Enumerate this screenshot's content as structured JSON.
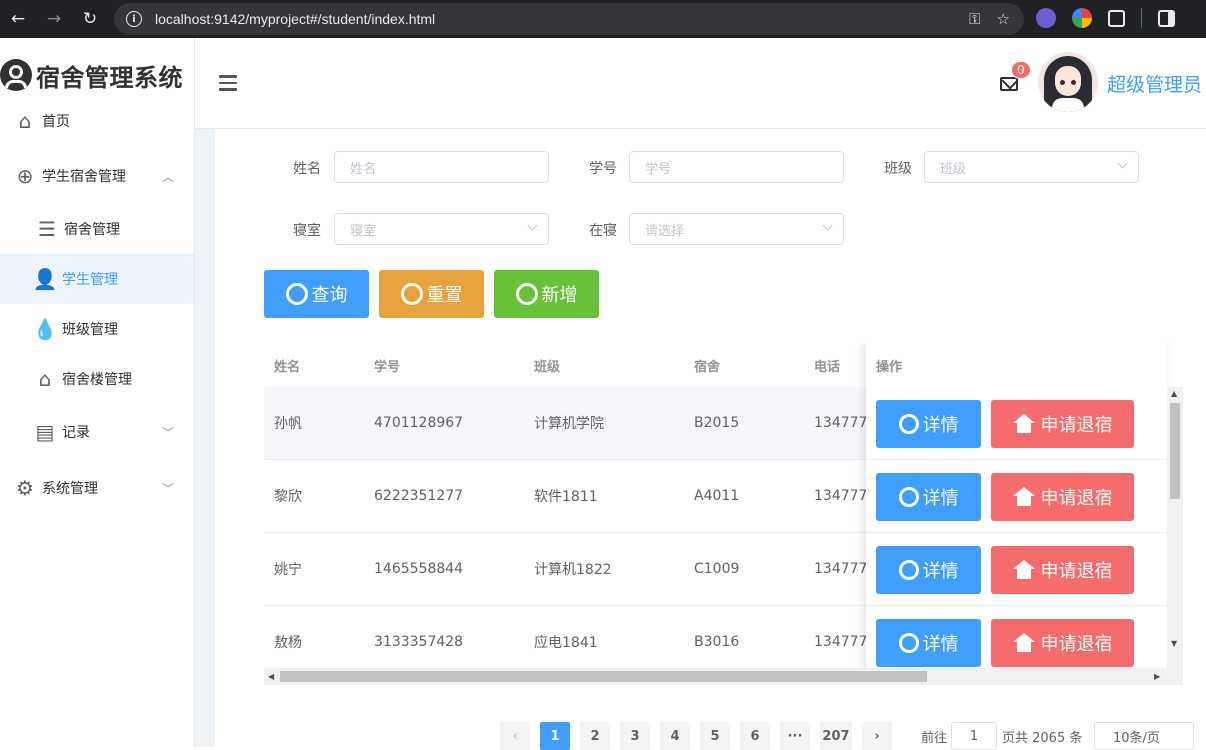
{
  "browser": {
    "url": "localhost:9142/myproject#/student/index.html"
  },
  "app": {
    "title": "宿舍管理系统",
    "username": "超级管理员",
    "message_count": "0"
  },
  "sidebar": {
    "items": [
      {
        "label": "首页",
        "icon": "home-icon"
      },
      {
        "label": "学生宿舍管理",
        "icon": "plus-circle-icon"
      },
      {
        "label": "宿舍管理",
        "icon": "list-icon"
      },
      {
        "label": "学生管理",
        "icon": "user-add-icon"
      },
      {
        "label": "班级管理",
        "icon": "drop-icon"
      },
      {
        "label": "宿舍楼管理",
        "icon": "house-icon"
      },
      {
        "label": "记录",
        "icon": "document-icon"
      },
      {
        "label": "系统管理",
        "icon": "gear-icon"
      }
    ]
  },
  "filters": {
    "name_label": "姓名",
    "name_placeholder": "姓名",
    "number_label": "学号",
    "number_placeholder": "学号",
    "class_label": "班级",
    "class_placeholder": "班级",
    "dorm_label": "寝室",
    "dorm_placeholder": "寝室",
    "instay_label": "在寝",
    "instay_placeholder": "请选择"
  },
  "actions": {
    "search": "查询",
    "reset": "重置",
    "add": "新增"
  },
  "table": {
    "headers": [
      "姓名",
      "学号",
      "班级",
      "宿舍",
      "电话",
      "操作"
    ],
    "rows": [
      {
        "name": "孙帆",
        "number": "4701128967",
        "class": "计算机学院",
        "dorm": "B2015",
        "phone": "134777"
      },
      {
        "name": "黎欣",
        "number": "6222351277",
        "class": "软件1811",
        "dorm": "A4011",
        "phone": "134777"
      },
      {
        "name": "姚宁",
        "number": "1465558844",
        "class": "计算机1822",
        "dorm": "C1009",
        "phone": "134777"
      },
      {
        "name": "敖杨",
        "number": "3133357428",
        "class": "应电1841",
        "dorm": "B3016",
        "phone": "134777"
      }
    ],
    "detail_label": "详情",
    "checkout_label": "申请退宿"
  },
  "pagination": {
    "pages": [
      "1",
      "2",
      "3",
      "4",
      "5",
      "6",
      "···",
      "207"
    ],
    "current": "1",
    "goto_label": "前往",
    "goto_value": "1",
    "total_text": "页共 2065 条",
    "page_size": "10条/页"
  }
}
